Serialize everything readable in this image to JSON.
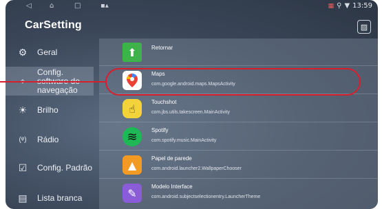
{
  "status": {
    "time": "13:59",
    "nav_back": "◁",
    "nav_home": "⌂",
    "nav_recent": "□"
  },
  "header": {
    "title": "CarSetting"
  },
  "sidebar": {
    "items": [
      {
        "label": "Geral",
        "icon": "gear-icon",
        "glyph": "⚙"
      },
      {
        "label": "Config. software de navegação",
        "icon": "navigation-icon",
        "glyph": "⌖"
      },
      {
        "label": "Brilho",
        "icon": "brightness-icon",
        "glyph": "☀"
      },
      {
        "label": "Rádio",
        "icon": "radio-icon",
        "glyph": "(ᵠ)"
      },
      {
        "label": "Config. Padrão",
        "icon": "checkbox-icon",
        "glyph": "☑"
      },
      {
        "label": "Lista branca",
        "icon": "list-icon",
        "glyph": "▤"
      }
    ]
  },
  "apps": [
    {
      "name": "Retornar",
      "package": "",
      "icon": "folder-up-icon",
      "glyph": "⬆",
      "color": "#3db34a"
    },
    {
      "name": "Maps",
      "package": "com.google.android.maps.MapsActivity",
      "icon": "maps-icon",
      "glyph": "📍",
      "color": "#ffffff"
    },
    {
      "name": "Touchshot",
      "package": "com.jbs.utils.takescreen.MainActivity",
      "icon": "touchshot-icon",
      "glyph": "☝",
      "color": "#f4d23a"
    },
    {
      "name": "Spotify",
      "package": "com.spotify.music.MainActivity",
      "icon": "spotify-icon",
      "glyph": "≋",
      "color": "#1db954"
    },
    {
      "name": "Papel de parede",
      "package": "com.android.launcher2.WallpaperChooser",
      "icon": "wallpaper-icon",
      "glyph": "▲",
      "color": "#f39a25"
    },
    {
      "name": "Modelo Interface",
      "package": "com.android.subjectselectionentry.LauncherTheme",
      "icon": "theme-icon",
      "glyph": "✎",
      "color": "#8a5cd8"
    }
  ],
  "colors": {
    "highlight": "#d81e2b"
  }
}
